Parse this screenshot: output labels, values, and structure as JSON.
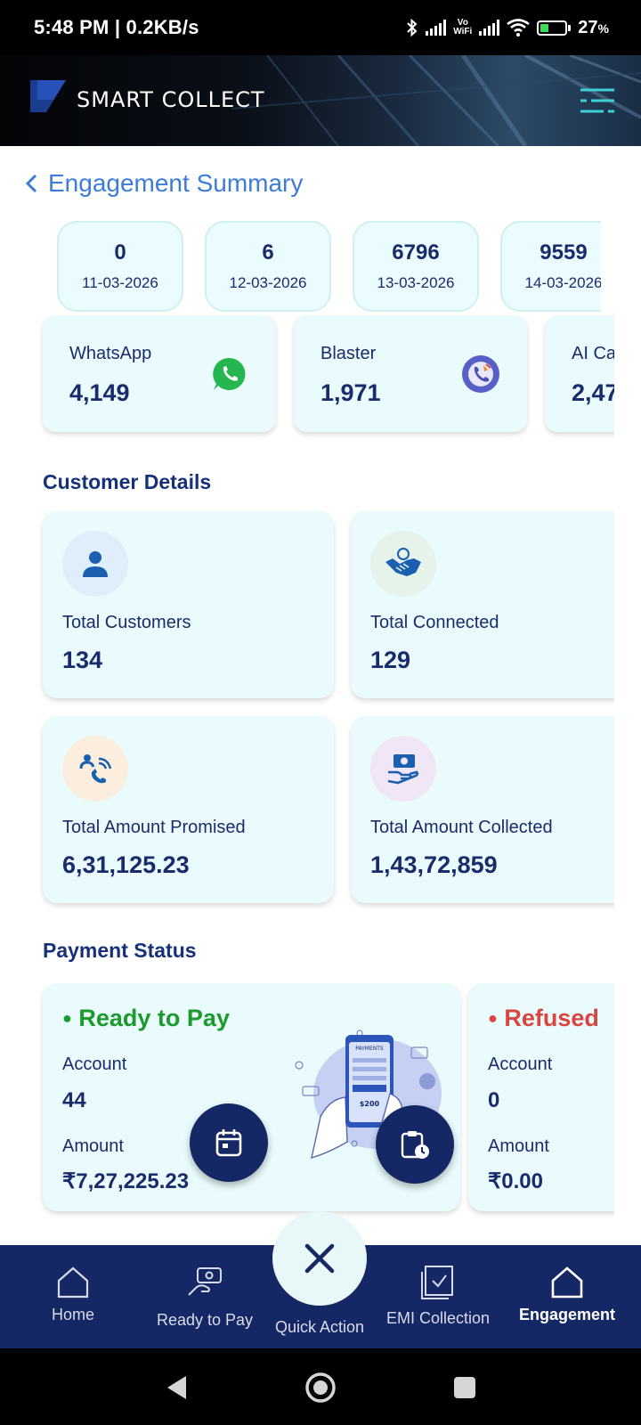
{
  "status_bar": {
    "time": "5:48 PM | 0.2KB/s",
    "vowifi_top": "Vo",
    "vowifi_bottom": "WiFi",
    "battery": "27",
    "battery_unit": "%"
  },
  "header": {
    "logo_text": "SMART COLLECT"
  },
  "page": {
    "title": "Engagement Summary"
  },
  "date_chips": [
    {
      "value": "0",
      "date": "11-03-2026"
    },
    {
      "value": "6",
      "date": "12-03-2026"
    },
    {
      "value": "6796",
      "date": "13-03-2026"
    },
    {
      "value": "9559",
      "date": "14-03-2026"
    }
  ],
  "channels": [
    {
      "label": "WhatsApp",
      "value": "4,149",
      "icon": "whatsapp-icon"
    },
    {
      "label": "Blaster",
      "value": "1,971",
      "icon": "blaster-call-icon"
    },
    {
      "label": "AI Ca",
      "value": "2,47",
      "icon": "ai-call-icon"
    }
  ],
  "customer_details": {
    "title": "Customer Details",
    "cards": [
      {
        "label": "Total Customers",
        "value": "134",
        "icon": "user-icon",
        "bg": "#dfeefa"
      },
      {
        "label": "Total Connected",
        "value": "129",
        "icon": "handshake-icon",
        "bg": "#e6f3ea"
      },
      {
        "label": "Total Amount Promised",
        "value": "6,31,125.23",
        "icon": "promise-call-icon",
        "bg": "#fbeede"
      },
      {
        "label": "Total Amount Collected",
        "value": "1,43,72,859",
        "icon": "cash-hand-icon",
        "bg": "#f1e6f5"
      }
    ]
  },
  "payment_status": {
    "title": "Payment Status",
    "cards": [
      {
        "status": "Ready to Pay",
        "dot": "●",
        "color": "#1c9a2e",
        "account_label": "Account",
        "account": "44",
        "amount_label": "Amount",
        "amount": "₹7,27,225.23"
      },
      {
        "status": "Refused",
        "dot": "●",
        "color": "#d9453f",
        "account_label": "Account",
        "account": "0",
        "amount_label": "Amount",
        "amount": "₹0.00"
      }
    ],
    "illustration_text": "PAYMENTS",
    "illustration_amount": "$200"
  },
  "bottom_nav": {
    "items": [
      {
        "label": "Home",
        "icon": "home-icon"
      },
      {
        "label": "Ready to Pay",
        "icon": "pay-hand-icon"
      },
      {
        "label": "Quick Action",
        "icon": "close-icon"
      },
      {
        "label": "EMI Collection",
        "icon": "checkbox-icon"
      },
      {
        "label": "Engagement",
        "icon": "engagement-home-icon"
      }
    ]
  },
  "colors": {
    "navy": "#152764",
    "title_blue": "#3d7bd9",
    "card_bg": "#e9fbfc",
    "ready_green": "#1c9a2e",
    "refused_red": "#d9453f"
  }
}
